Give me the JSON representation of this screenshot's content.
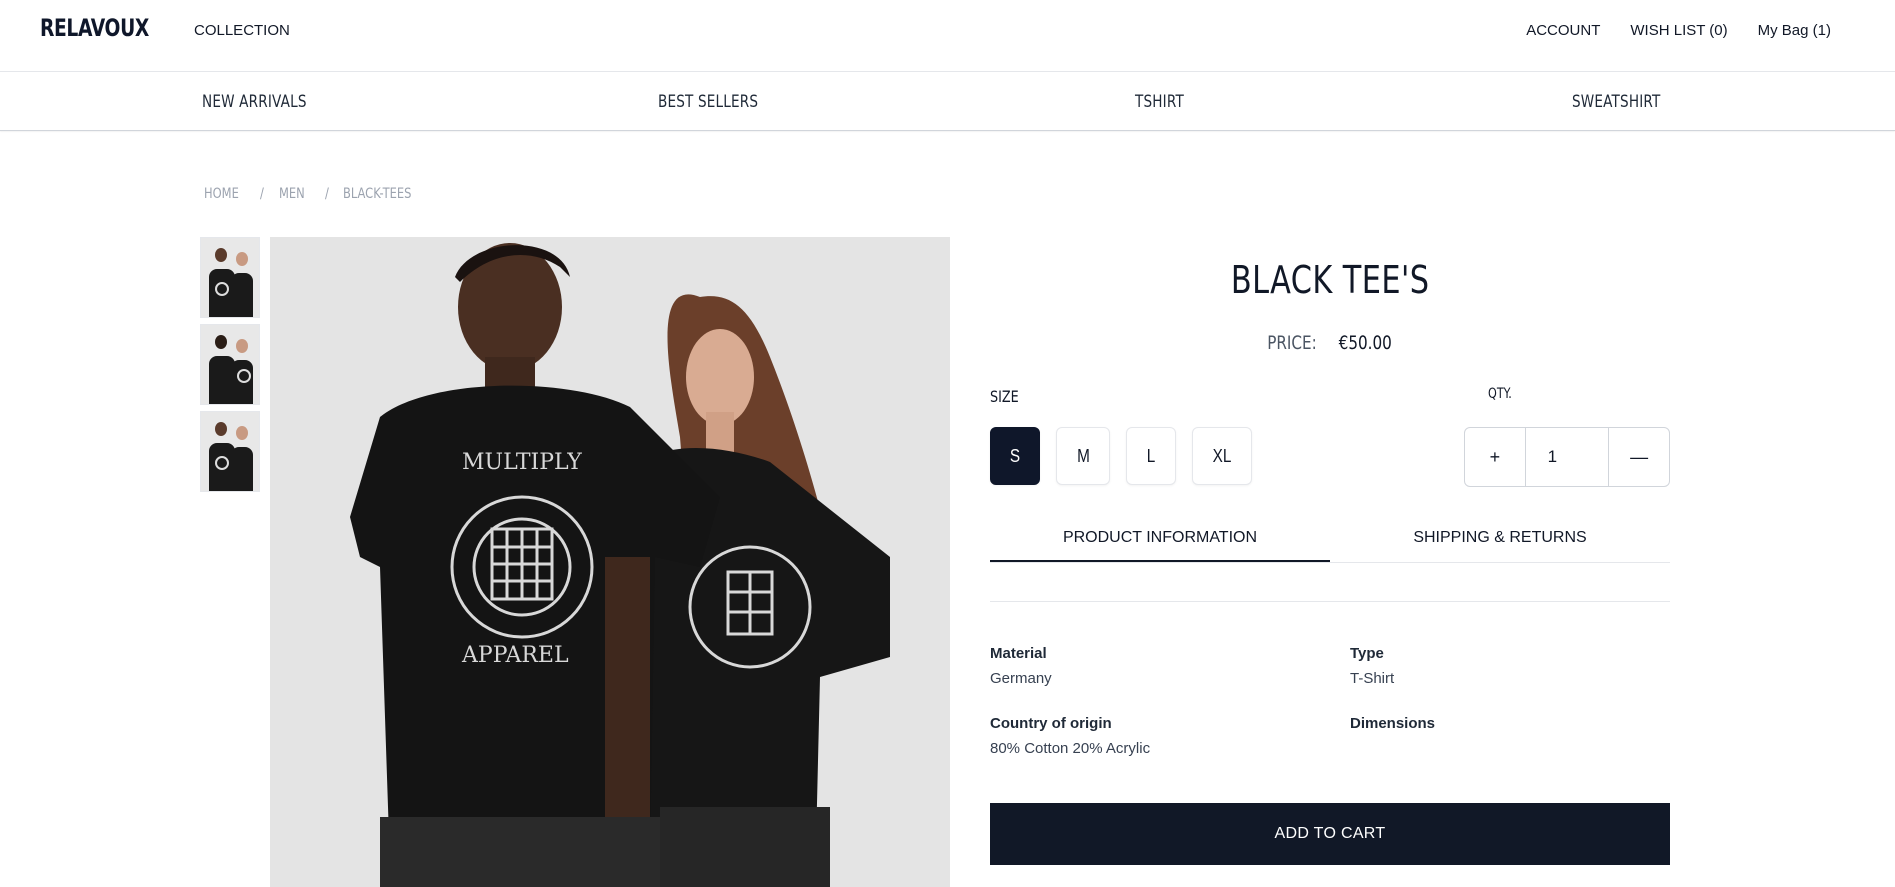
{
  "header": {
    "logo": "RELAVOUX",
    "collection": "COLLECTION",
    "account": "ACCOUNT",
    "wishlist": "WISH LIST (0)",
    "bag": "My Bag (1)"
  },
  "categories": [
    "NEW ARRIVALS",
    "BEST SELLERS",
    "TSHIRT",
    "SWEATSHIRT"
  ],
  "breadcrumb": [
    "HOME",
    "MEN",
    "BLACK-TEES"
  ],
  "product": {
    "title": "BLACK TEE'S",
    "price_label": "PRICE:",
    "price": "€50.00",
    "size_label": "SIZE",
    "sizes": [
      "S",
      "M",
      "L",
      "XL"
    ],
    "selected_size": "S",
    "qty_label": "QTY.",
    "qty_plus": "+",
    "qty_value": "1",
    "qty_minus": "—",
    "tabs": [
      "PRODUCT INFORMATION",
      "SHIPPING & RETURNS"
    ],
    "active_tab": "PRODUCT INFORMATION",
    "info": {
      "material_label": "Material",
      "material": "Germany",
      "type_label": "Type",
      "type": "T-Shirt",
      "origin_label": "Country of origin",
      "origin": "80% Cotton 20% Acrylic",
      "dimensions_label": "Dimensions",
      "dimensions": ""
    },
    "add_to_cart": "ADD TO CART",
    "graphic_text_top": "MULTIPLY",
    "graphic_text_bottom": "APPAREL"
  },
  "colors": {
    "primary": "#111827",
    "active_size": "#0f172a",
    "border": "#e5e7eb",
    "muted": "#9ca3af"
  }
}
